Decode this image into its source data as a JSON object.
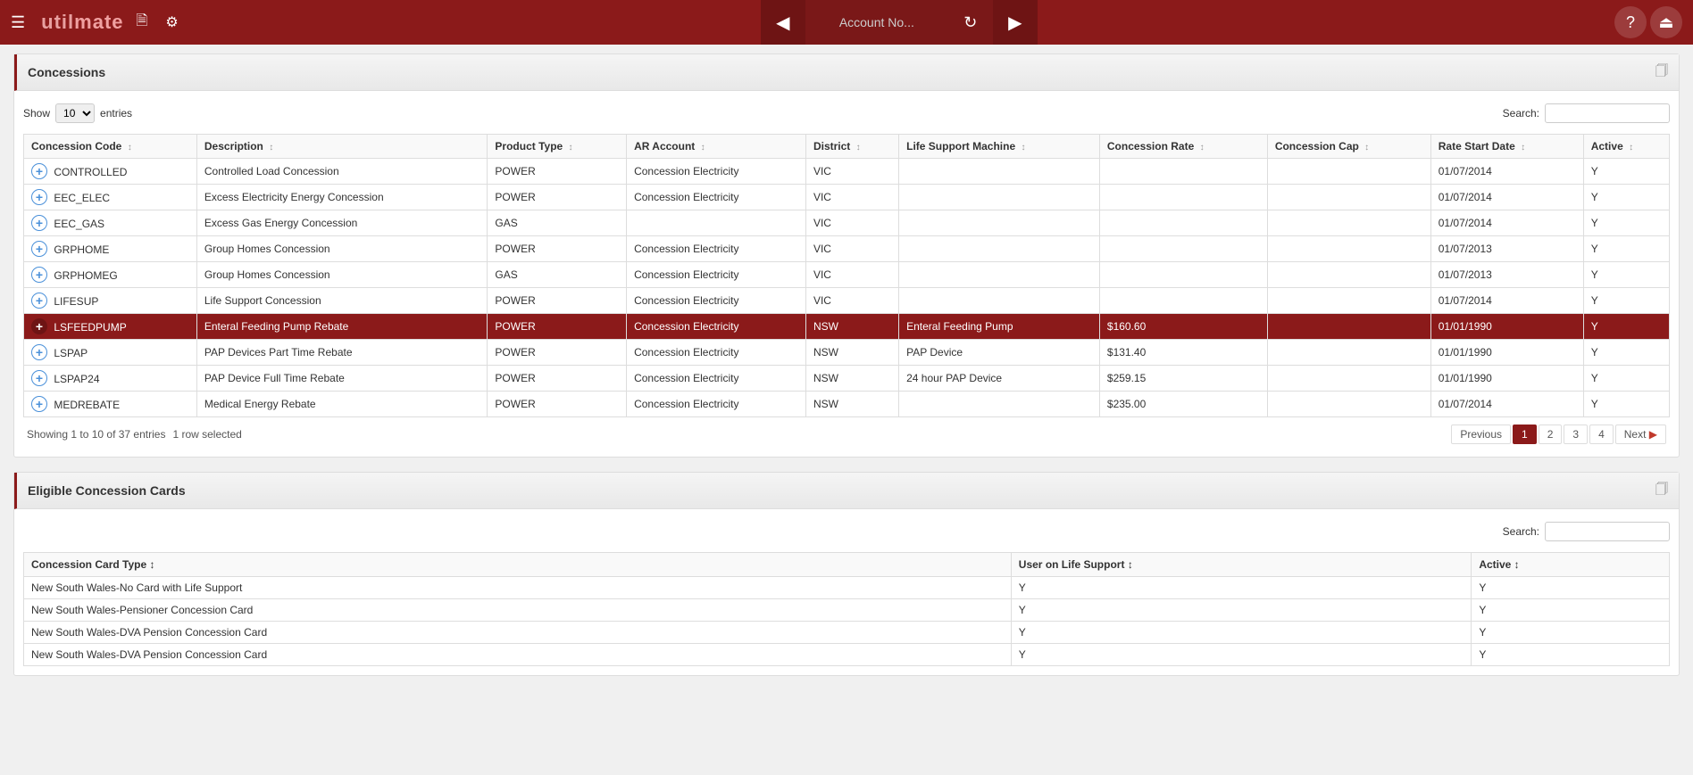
{
  "app": {
    "title": "utilmate",
    "title_prefix": "util",
    "title_suffix": "mate"
  },
  "header": {
    "account_placeholder": "Account No...",
    "nav": {
      "prev_label": "◀",
      "next_label": "▶",
      "reset_label": "↺"
    },
    "help_icon": "?",
    "power_icon": "⏻"
  },
  "concessions_section": {
    "title": "Concessions",
    "show_label": "Show",
    "entries_label": "entries",
    "show_value": "10",
    "search_label": "Search:",
    "columns": [
      "Concession Code",
      "Description",
      "Product Type",
      "AR Account",
      "District",
      "Life Support Machine",
      "Concession Rate",
      "Concession Cap",
      "Rate Start Date",
      "Active"
    ],
    "rows": [
      {
        "code": "CONTROLLED",
        "description": "Controlled Load Concession",
        "product_type": "POWER",
        "ar_account": "Concession Electricity",
        "district": "VIC",
        "life_support": "",
        "rate": "",
        "cap": "",
        "rate_start": "01/07/2014",
        "active": "Y",
        "selected": false
      },
      {
        "code": "EEC_ELEC",
        "description": "Excess Electricity Energy Concession",
        "product_type": "POWER",
        "ar_account": "Concession Electricity",
        "district": "VIC",
        "life_support": "",
        "rate": "",
        "cap": "",
        "rate_start": "01/07/2014",
        "active": "Y",
        "selected": false
      },
      {
        "code": "EEC_GAS",
        "description": "Excess Gas Energy Concession",
        "product_type": "GAS",
        "ar_account": "",
        "district": "VIC",
        "life_support": "",
        "rate": "",
        "cap": "",
        "rate_start": "01/07/2014",
        "active": "Y",
        "selected": false
      },
      {
        "code": "GRPHOME",
        "description": "Group Homes Concession",
        "product_type": "POWER",
        "ar_account": "Concession Electricity",
        "district": "VIC",
        "life_support": "",
        "rate": "",
        "cap": "",
        "rate_start": "01/07/2013",
        "active": "Y",
        "selected": false
      },
      {
        "code": "GRPHOMEG",
        "description": "Group Homes Concession",
        "product_type": "GAS",
        "ar_account": "Concession Electricity",
        "district": "VIC",
        "life_support": "",
        "rate": "",
        "cap": "",
        "rate_start": "01/07/2013",
        "active": "Y",
        "selected": false
      },
      {
        "code": "LIFESUP",
        "description": "Life Support Concession",
        "product_type": "POWER",
        "ar_account": "Concession Electricity",
        "district": "VIC",
        "life_support": "",
        "rate": "",
        "cap": "",
        "rate_start": "01/07/2014",
        "active": "Y",
        "selected": false
      },
      {
        "code": "LSFEEDPUMP",
        "description": "Enteral Feeding Pump Rebate",
        "product_type": "POWER",
        "ar_account": "Concession Electricity",
        "district": "NSW",
        "life_support": "Enteral Feeding Pump",
        "rate": "$160.60",
        "cap": "",
        "rate_start": "01/01/1990",
        "active": "Y",
        "selected": true
      },
      {
        "code": "LSPAP",
        "description": "PAP Devices Part Time Rebate",
        "product_type": "POWER",
        "ar_account": "Concession Electricity",
        "district": "NSW",
        "life_support": "PAP Device",
        "rate": "$131.40",
        "cap": "",
        "rate_start": "01/01/1990",
        "active": "Y",
        "selected": false
      },
      {
        "code": "LSPAP24",
        "description": "PAP Device Full Time Rebate",
        "product_type": "POWER",
        "ar_account": "Concession Electricity",
        "district": "NSW",
        "life_support": "24 hour PAP Device",
        "rate": "$259.15",
        "cap": "",
        "rate_start": "01/01/1990",
        "active": "Y",
        "selected": false
      },
      {
        "code": "MEDREBATE",
        "description": "Medical Energy Rebate",
        "product_type": "POWER",
        "ar_account": "Concession Electricity",
        "district": "NSW",
        "life_support": "",
        "rate": "$235.00",
        "cap": "",
        "rate_start": "01/07/2014",
        "active": "Y",
        "selected": false
      }
    ],
    "pagination": {
      "info": "Showing 1 to 10 of 37 entries",
      "row_selected": "1 row selected",
      "prev_label": "Previous",
      "next_label": "Next",
      "pages": [
        "1",
        "2",
        "3",
        "4"
      ],
      "active_page": "1",
      "total_entries": "37"
    }
  },
  "eligible_cards_section": {
    "title": "Eligible Concession Cards",
    "search_label": "Search:",
    "columns": [
      "Concession Card Type",
      "User on Life Support",
      "Active"
    ],
    "rows": [
      {
        "card_type": "New South Wales-No Card with Life Support",
        "life_support": "Y",
        "active": "Y"
      },
      {
        "card_type": "New South Wales-Pensioner Concession Card",
        "life_support": "Y",
        "active": "Y"
      },
      {
        "card_type": "New South Wales-DVA Pension Concession Card",
        "life_support": "Y",
        "active": "Y"
      },
      {
        "card_type": "New South Wales-DVA Pension Concession Card",
        "life_support": "Y",
        "active": "Y"
      }
    ]
  }
}
